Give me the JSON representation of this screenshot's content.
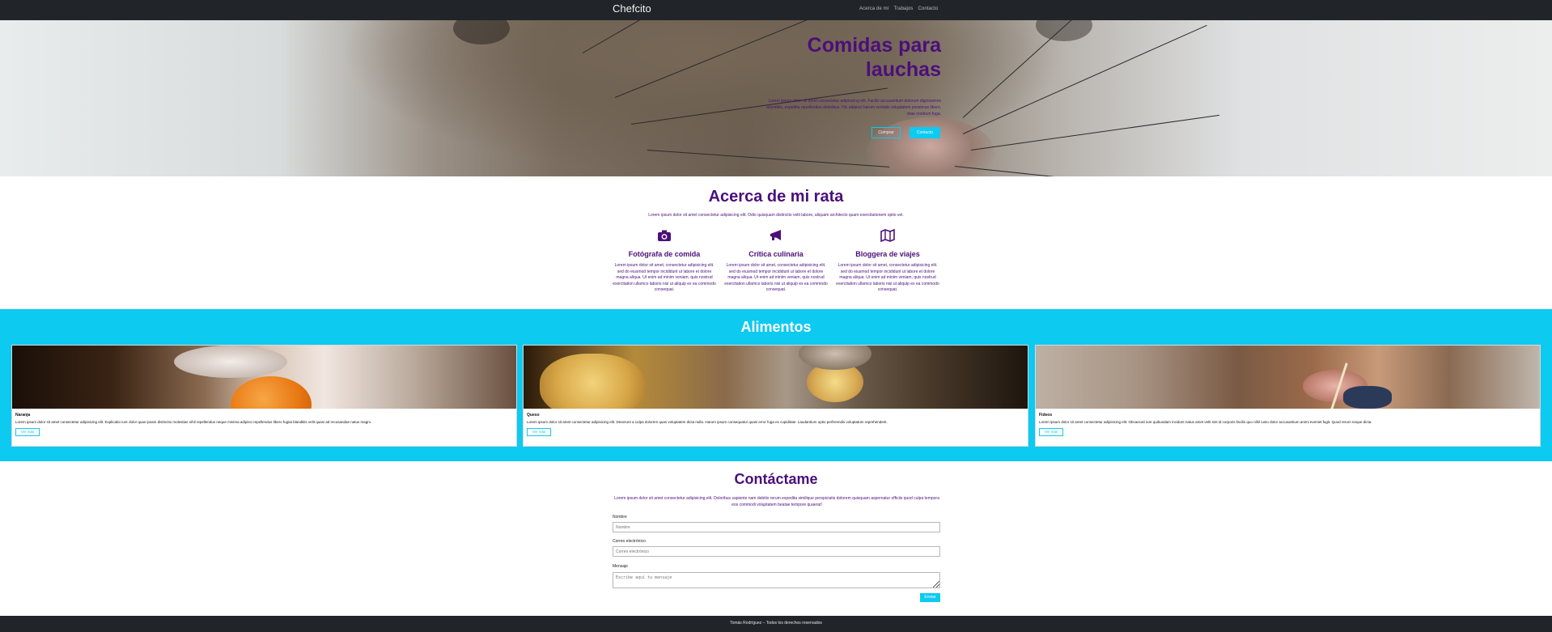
{
  "navbar": {
    "brand": "Chefcito",
    "links": [
      "Acerca de mí",
      "Trabajos",
      "Contacto"
    ]
  },
  "hero": {
    "title": "Comidas para lauchas",
    "text": "Lorem ipsum dolor sit amet consectetur adipisicing elit. Facilis accusantium dolorum dignissimos blanditiis, expedita repellendus doloribus. Hic adipisci harum veritatis voluptatem possimus libero, vitae nostrum fuga.",
    "button_outline": "Comprar",
    "button_solid": "Contacto"
  },
  "about": {
    "title": "Acerca de mi rata",
    "subtitle": "Lorem ipsum dolor sit amet consectetur adipisicing elit. Odio quisquam distinctio velit labore, aliquam architecto quam exercitationem optio vel.",
    "features": [
      {
        "icon": "camera-icon",
        "title": "Fotógrafa de comida",
        "text": "Lorem ipsum dolor sit amet, consectetur adipisicing elit. sed do eiusmod tempor incididunt ut labore et dolore magna aliqua. Ut enim ad minim veniam, quis nostrud exercitation ullamco laboris nisi ut aliquip ex ea commodo consequat."
      },
      {
        "icon": "megaphone-icon",
        "title": "Crítica culinaria",
        "text": "Lorem ipsum dolor sit amet, consectetur adipisicing elit. sed do eiusmod tempor incididunt ut labore et dolore magna aliqua. Ut enim ad minim veniam, quis nostrud exercitation ullamco laboris nisi ut aliquip ex ea commodo consequat."
      },
      {
        "icon": "map-icon",
        "title": "Bloggera de viajes",
        "text": "Lorem ipsum dolor sit amet, consectetur adipisicing elit. sed do eiusmod tempor incididunt ut labore et dolore magna aliqua. Ut enim ad minim veniam, quis nostrud exercitation ullamco laboris nisi ut aliquip ex ea commodo consequat."
      }
    ]
  },
  "foods": {
    "title": "Alimentos",
    "cards": [
      {
        "title": "Naranja",
        "text": "Lorem ipsum dolor sit amet consectetur adipisicing elit. Explicabo iure dolor quas ipsam distinctio molestias nihil repellendus neque minima adipisci repellendus libero fugiat blanditiis velit quasi ad recusandae natus magni.",
        "button": "Ver más"
      },
      {
        "title": "Queso",
        "text": "Lorem ipsum dolor sit amet consectetur adipisicing elit. Deserunt a culpa dolorem quas voluptatem dicta nulla. Harum ipsum consequatur quasi error fuga ex cupiditate. Laudantium optio perferendis voluptatum reprehenderit.",
        "button": "Ver más"
      },
      {
        "title": "Fideos",
        "text": "Lorem ipsum dolor sit amet consectetur adipisicing elit. Obcaecati iure quibusdam incidunt natus amet velit sint id corporis facilis quo nihil iusto dolor accusantium animi eveniet fugit. Quod rerum neque dicta.",
        "button": "Ver más"
      }
    ]
  },
  "contact": {
    "title": "Contáctame",
    "subtitle": "Lorem ipsum dolor sit amet consectetur adipisicing elit. Doloribus sapiente nam debitis rerum expedita similique perspiciatis dolorem quisquam aspernatur officiis quod culpa tempora eos commodi voluptatem beatae tempore quaerat!",
    "fields": [
      {
        "label": "Nombre",
        "placeholder": "Nombre"
      },
      {
        "label": "Correo electrónico",
        "placeholder": "Correo electrónico"
      },
      {
        "label": "Mensaje",
        "placeholder": "Escribe aquí tu mensaje"
      }
    ],
    "send": "Enviar"
  },
  "footer": {
    "text": "Tomás Rodríguez – Todos los derechos reservados"
  }
}
